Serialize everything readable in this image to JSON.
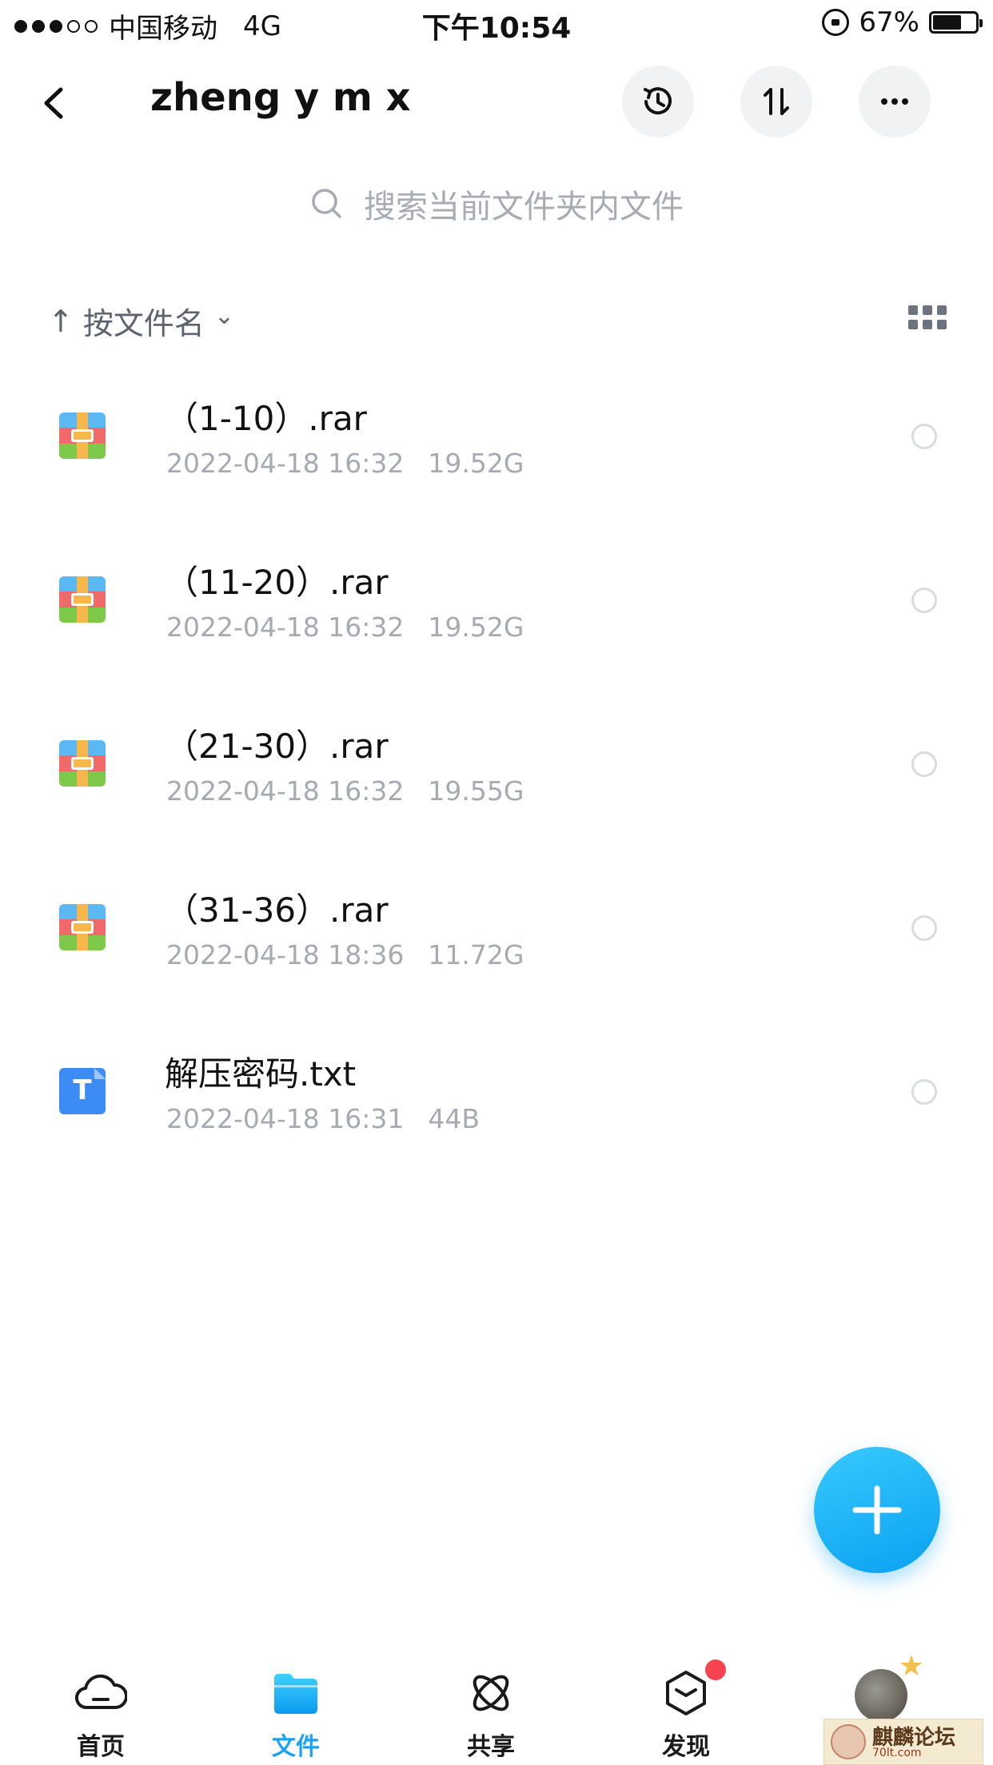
{
  "status_bar": {
    "carrier": "中国移动",
    "network": "4G",
    "time": "下午10:54",
    "battery": "67%",
    "battery_level": 0.67
  },
  "header": {
    "title": "zheng y m x"
  },
  "search": {
    "placeholder": "搜索当前文件夹内文件"
  },
  "sort": {
    "arrow": "↑",
    "label": "按文件名",
    "chevron": "⌄"
  },
  "files": [
    {
      "name": "（1-10）.rar",
      "date": "2022-04-18 16:32",
      "size": "19.52G",
      "icon": "rar-archive-icon"
    },
    {
      "name": "（11-20）.rar",
      "date": "2022-04-18 16:32",
      "size": "19.52G",
      "icon": "rar-archive-icon"
    },
    {
      "name": "（21-30）.rar",
      "date": "2022-04-18 16:32",
      "size": "19.55G",
      "icon": "rar-archive-icon"
    },
    {
      "name": "（31-36）.rar",
      "date": "2022-04-18 18:36",
      "size": "11.72G",
      "icon": "rar-archive-icon"
    },
    {
      "name": "解压密码.txt",
      "date": "2022-04-18 16:31",
      "size": "44B",
      "icon": "text-file-icon",
      "icon_letter": "T"
    }
  ],
  "tabbar": {
    "tabs": [
      {
        "label": "首页",
        "icon": "cloud-icon"
      },
      {
        "label": "文件",
        "icon": "folder-icon",
        "active": true
      },
      {
        "label": "共享",
        "icon": "orbit-icon"
      },
      {
        "label": "发现",
        "icon": "cube-icon",
        "badge": true
      },
      {
        "label": "",
        "icon": "avatar"
      }
    ]
  },
  "watermark": {
    "title": "麒麟论坛",
    "subtitle": "70lt.com"
  },
  "colors": {
    "accent": "#1aa3f2",
    "badge": "#f5444f",
    "meta_text": "#a6aab2"
  }
}
